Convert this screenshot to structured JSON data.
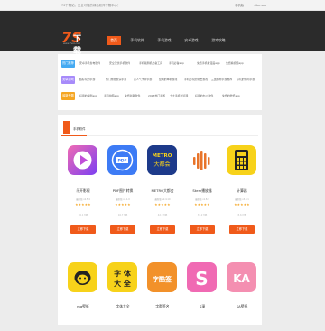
{
  "topbar": {
    "welcome": "7S下载站，安全可靠的绿色软件下载中心！",
    "links": [
      "手机版",
      "sitemap"
    ]
  },
  "logo": {
    "mark": "7S",
    "text": "下载",
    "sub": "www.7sxz.com"
  },
  "nav": [
    {
      "label": "首页",
      "active": true
    },
    {
      "label": "手机软件",
      "active": false
    },
    {
      "label": "手机游戏",
      "active": false
    },
    {
      "label": "安卓游戏",
      "active": false
    },
    {
      "label": "游戏攻略",
      "active": false
    }
  ],
  "categories": [
    {
      "tag": "热门推荐",
      "color": "#45aaf2",
      "links": [
        "安卓手机省电软件",
        "安全无忧手机软件",
        "手机版刷机必备工具",
        "手机必备app",
        "免费手机看漫画app",
        "免费看视频app"
      ]
    },
    {
      "tag": "安卓游戏",
      "color": "#a78bfa",
      "links": [
        "超好玩的手游",
        "热门角色扮演手游",
        "高人气卡牌手游",
        "经典的单机游戏",
        "手机必玩的射击游戏",
        "三国题材手游推荐",
        "好玩的休闲手游"
      ]
    },
    {
      "tag": "最新专题",
      "color": "#f5a623",
      "links": [
        "好用的看剧app",
        "手机拍照app",
        "免费听歌软件",
        "2023热门手游",
        "十大手机浏览器",
        "好用的办公软件",
        "免费的壁纸app"
      ]
    }
  ],
  "section": {
    "title": "手机软件"
  },
  "apps_row1": [
    {
      "name": "乐开影视",
      "meta": "最新版 v2.5.4",
      "stars": "★★★★★",
      "size": "26.1 MB",
      "button": "立即下载",
      "bg": "linear-gradient(135deg,#f06ab3,#7b3ff2)",
      "icon": "play"
    },
    {
      "name": "PDF图片转换",
      "meta": "最新版 v2.1.0",
      "stars": "★★★★★",
      "size": "16.7 MB",
      "button": "立即下载",
      "bg": "#3d7bf5",
      "icon": "pdf"
    },
    {
      "name": "METRO大都会",
      "meta": "最新版 v2.4.10",
      "stars": "★★★★★",
      "size": "42.9 MB",
      "button": "立即下载",
      "bg": "#1d3a8a",
      "icon": "metro"
    },
    {
      "name": "Stem播放器",
      "meta": "最新版 v1.8.3",
      "stars": "★★★★★",
      "size": "31.2 MB",
      "button": "立即下载",
      "bg": "#fff",
      "icon": "wave"
    },
    {
      "name": "计算器",
      "meta": "最新版 v3.0.1",
      "stars": "★★★★★",
      "size": "8.6 MB",
      "button": "立即下载",
      "bg": "#f7d21a",
      "icon": "calc"
    }
  ],
  "apps_row2": [
    {
      "name": "mg壁纸",
      "bg": "#f7d21a",
      "icon": "dog"
    },
    {
      "name": "字体大全",
      "bg": "#f7d21a",
      "icon": "font"
    },
    {
      "name": "字酷签名",
      "bg": "#f2912a",
      "icon": "sign"
    },
    {
      "name": "S漫",
      "bg": "#f06ab3",
      "icon": "s"
    },
    {
      "name": "KA壁纸",
      "bg": "#f48fb1",
      "icon": "ka"
    }
  ],
  "icon_text": {
    "pdf": "PDF",
    "metro": "METRO",
    "metro_sub": "大都会",
    "font": "字 体\n大 全",
    "sign": "字酷签",
    "s": "S",
    "ka": "KA"
  }
}
